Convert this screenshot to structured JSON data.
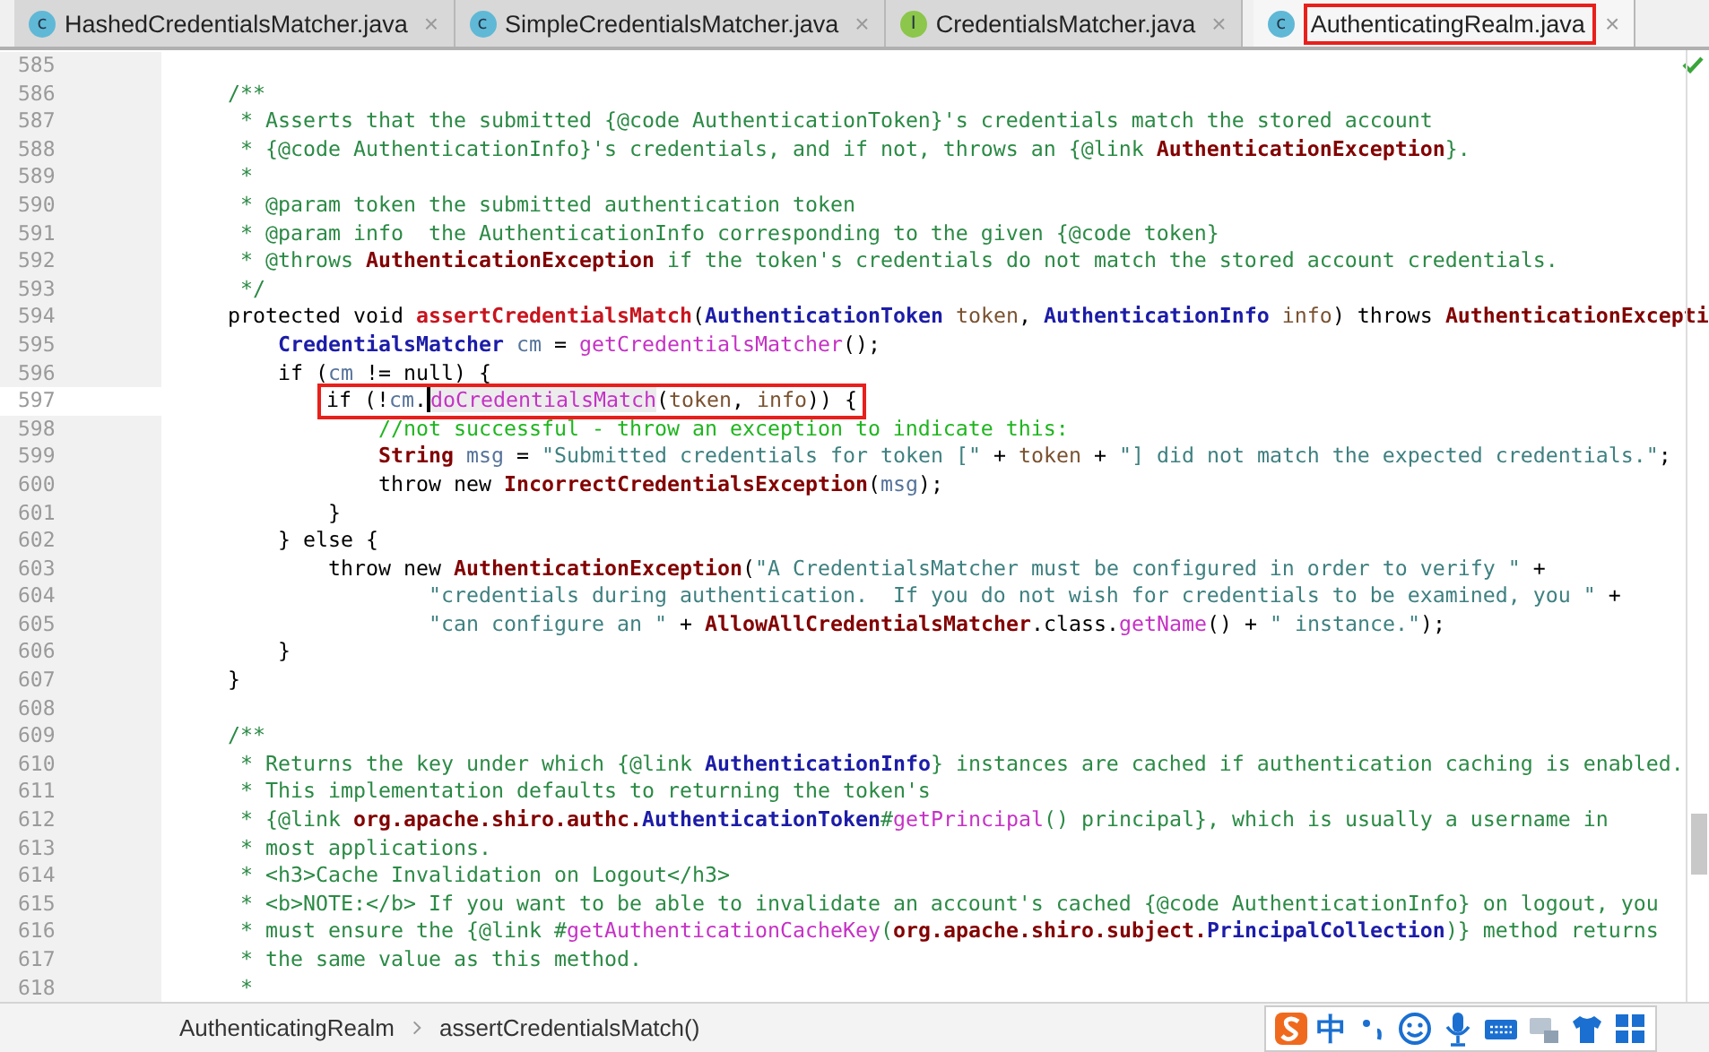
{
  "tabs": [
    {
      "color": "#5fb8d6",
      "icon_letter": "c",
      "label": "HashedCredentialsMatcher.java",
      "close": "×",
      "selected": false,
      "annotated": false
    },
    {
      "color": "#5fb8d6",
      "icon_letter": "c",
      "label": "SimpleCredentialsMatcher.java",
      "close": "×",
      "selected": false,
      "annotated": false
    },
    {
      "color": "#8cc64a",
      "icon_letter": "I",
      "label": "CredentialsMatcher.java",
      "close": "×",
      "selected": false,
      "annotated": false
    },
    {
      "color": "#5fb8d6",
      "icon_letter": "c",
      "label": "AuthenticatingRealm.java",
      "close": "×",
      "selected": true,
      "annotated": true
    }
  ],
  "editor": {
    "lines": [
      {
        "number": "585"
      },
      {
        "number": "586",
        "tokens": [
          {
            "kind": "doc",
            "text": "    /**"
          }
        ]
      },
      {
        "number": "587",
        "tokens": [
          {
            "kind": "doc",
            "text": "     * Asserts that the submitted {@code AuthenticationToken}'s credentials match the stored account"
          }
        ]
      },
      {
        "number": "588",
        "tokens": [
          {
            "kind": "doc",
            "text": "     * {@code AuthenticationInfo}'s credentials, and if not, throws an {@link "
          },
          {
            "kind": "class",
            "text": "AuthenticationException"
          },
          {
            "kind": "doc",
            "text": "}."
          }
        ]
      },
      {
        "number": "589",
        "tokens": [
          {
            "kind": "doc",
            "text": "     *"
          }
        ]
      },
      {
        "number": "590",
        "tokens": [
          {
            "kind": "doc",
            "text": "     * @param token the submitted authentication token"
          }
        ]
      },
      {
        "number": "591",
        "tokens": [
          {
            "kind": "doc",
            "text": "     * @param info  the AuthenticationInfo corresponding to the given {@code token}"
          }
        ]
      },
      {
        "number": "592",
        "tokens": [
          {
            "kind": "doc",
            "text": "     * @throws "
          },
          {
            "kind": "class",
            "text": "AuthenticationException"
          },
          {
            "kind": "doc",
            "text": " if the token's credentials do not match the stored account credentials."
          }
        ]
      },
      {
        "number": "593",
        "tokens": [
          {
            "kind": "doc",
            "text": "     */"
          }
        ]
      },
      {
        "number": "594",
        "tokens": [
          {
            "kind": "plain",
            "text": "    protected void "
          },
          {
            "kind": "declaration",
            "text": "assertCredentialsMatch"
          },
          {
            "kind": "plain",
            "text": "("
          },
          {
            "kind": "type",
            "text": "AuthenticationToken"
          },
          {
            "kind": "parameter",
            "text": " token"
          },
          {
            "kind": "plain",
            "text": ", "
          },
          {
            "kind": "type",
            "text": "AuthenticationInfo"
          },
          {
            "kind": "parameter",
            "text": " info"
          },
          {
            "kind": "plain",
            "text": ") throws "
          },
          {
            "kind": "class",
            "text": "AuthenticationExcepti"
          }
        ]
      },
      {
        "number": "595",
        "tokens": [
          {
            "kind": "type",
            "text": "        CredentialsMatcher"
          },
          {
            "kind": "local",
            "text": " cm"
          },
          {
            "kind": "plain",
            "text": " = "
          },
          {
            "kind": "method",
            "text": "getCredentialsMatcher"
          },
          {
            "kind": "plain",
            "text": "();"
          }
        ]
      },
      {
        "number": "596",
        "tokens": [
          {
            "kind": "plain",
            "text": "        if ("
          },
          {
            "kind": "local",
            "text": "cm"
          },
          {
            "kind": "plain",
            "text": " != null) {"
          }
        ]
      },
      {
        "number": "597",
        "current": true,
        "annotated": true,
        "tokens": [
          {
            "kind": "plain",
            "text": "            if (!"
          },
          {
            "kind": "local",
            "text": "cm"
          },
          {
            "kind": "plain",
            "text": "."
          },
          {
            "kind": "method",
            "text": "doCredentialsMatch",
            "caret": true,
            "highlighted": true
          },
          {
            "kind": "plain",
            "text": "("
          },
          {
            "kind": "parameter",
            "text": "token"
          },
          {
            "kind": "plain",
            "text": ", "
          },
          {
            "kind": "parameter",
            "text": "info"
          },
          {
            "kind": "plain",
            "text": ")) {"
          }
        ]
      },
      {
        "number": "598",
        "tokens": [
          {
            "kind": "comment",
            "text": "                //not successful - throw an exception to indicate this:"
          }
        ]
      },
      {
        "number": "599",
        "tokens": [
          {
            "kind": "class",
            "text": "                String"
          },
          {
            "kind": "local",
            "text": " msg"
          },
          {
            "kind": "plain",
            "text": " = "
          },
          {
            "kind": "string",
            "text": "\"Submitted credentials for token [\""
          },
          {
            "kind": "plain",
            "text": " + "
          },
          {
            "kind": "parameter",
            "text": "token"
          },
          {
            "kind": "plain",
            "text": " + "
          },
          {
            "kind": "string",
            "text": "\"] did not match the expected credentials.\""
          },
          {
            "kind": "plain",
            "text": ";"
          }
        ]
      },
      {
        "number": "600",
        "tokens": [
          {
            "kind": "plain",
            "text": "                throw new "
          },
          {
            "kind": "class",
            "text": "IncorrectCredentialsException"
          },
          {
            "kind": "plain",
            "text": "("
          },
          {
            "kind": "local",
            "text": "msg"
          },
          {
            "kind": "plain",
            "text": ");"
          }
        ]
      },
      {
        "number": "601",
        "tokens": [
          {
            "kind": "plain",
            "text": "            }"
          }
        ]
      },
      {
        "number": "602",
        "tokens": [
          {
            "kind": "plain",
            "text": "        } else {"
          }
        ]
      },
      {
        "number": "603",
        "tokens": [
          {
            "kind": "plain",
            "text": "            throw new "
          },
          {
            "kind": "class",
            "text": "AuthenticationException"
          },
          {
            "kind": "plain",
            "text": "("
          },
          {
            "kind": "string",
            "text": "\"A CredentialsMatcher must be configured in order to verify \""
          },
          {
            "kind": "plain",
            "text": " +"
          }
        ]
      },
      {
        "number": "604",
        "tokens": [
          {
            "kind": "string",
            "text": "                    \"credentials during authentication.  If you do not wish for credentials to be examined, you \""
          },
          {
            "kind": "plain",
            "text": " +"
          }
        ]
      },
      {
        "number": "605",
        "tokens": [
          {
            "kind": "string",
            "text": "                    \"can configure an \""
          },
          {
            "kind": "plain",
            "text": " + "
          },
          {
            "kind": "class",
            "text": "AllowAllCredentialsMatcher"
          },
          {
            "kind": "plain",
            "text": ".class."
          },
          {
            "kind": "method",
            "text": "getName"
          },
          {
            "kind": "plain",
            "text": "() + "
          },
          {
            "kind": "string",
            "text": "\" instance.\""
          },
          {
            "kind": "plain",
            "text": ");"
          }
        ]
      },
      {
        "number": "606",
        "tokens": [
          {
            "kind": "plain",
            "text": "        }"
          }
        ]
      },
      {
        "number": "607",
        "tokens": [
          {
            "kind": "plain",
            "text": "    }"
          }
        ]
      },
      {
        "number": "608"
      },
      {
        "number": "609",
        "tokens": [
          {
            "kind": "doc",
            "text": "    /**"
          }
        ]
      },
      {
        "number": "610",
        "tokens": [
          {
            "kind": "doc",
            "text": "     * Returns the key under which {@link "
          },
          {
            "kind": "type",
            "text": "AuthenticationInfo"
          },
          {
            "kind": "doc",
            "text": "} instances are cached if authentication caching is enabled."
          }
        ]
      },
      {
        "number": "611",
        "tokens": [
          {
            "kind": "doc",
            "text": "     * This implementation defaults to returning the token's"
          }
        ]
      },
      {
        "number": "612",
        "tokens": [
          {
            "kind": "doc",
            "text": "     * {@link "
          },
          {
            "kind": "class",
            "text": "org.apache.shiro.authc."
          },
          {
            "kind": "type",
            "text": "AuthenticationToken"
          },
          {
            "kind": "doc",
            "text": "#"
          },
          {
            "kind": "method",
            "text": "getPrincipal"
          },
          {
            "kind": "doc",
            "text": "() principal}, which is usually a username in"
          }
        ]
      },
      {
        "number": "613",
        "tokens": [
          {
            "kind": "doc",
            "text": "     * most applications."
          }
        ]
      },
      {
        "number": "614",
        "tokens": [
          {
            "kind": "doc",
            "text": "     * <h3>Cache Invalidation on Logout</h3>"
          }
        ]
      },
      {
        "number": "615",
        "tokens": [
          {
            "kind": "doc",
            "text": "     * <b>NOTE:</b> If you want to be able to invalidate an account's cached {@code AuthenticationInfo} on logout, you"
          }
        ]
      },
      {
        "number": "616",
        "tokens": [
          {
            "kind": "doc",
            "text": "     * must ensure the {@link #"
          },
          {
            "kind": "method",
            "text": "getAuthenticationCacheKey"
          },
          {
            "kind": "doc",
            "text": "("
          },
          {
            "kind": "class",
            "text": "org.apache.shiro.subject."
          },
          {
            "kind": "type",
            "text": "PrincipalCollection"
          },
          {
            "kind": "doc",
            "text": ")} method returns"
          }
        ]
      },
      {
        "number": "617",
        "tokens": [
          {
            "kind": "doc",
            "text": "     * the same value as this method."
          }
        ]
      },
      {
        "number": "618",
        "tokens": [
          {
            "kind": "doc",
            "text": "     *"
          }
        ]
      }
    ]
  },
  "breadcrumb": [
    "AuthenticatingRealm",
    "assertCredentialsMatch()"
  ],
  "ime_bar": {
    "mode": "中"
  }
}
